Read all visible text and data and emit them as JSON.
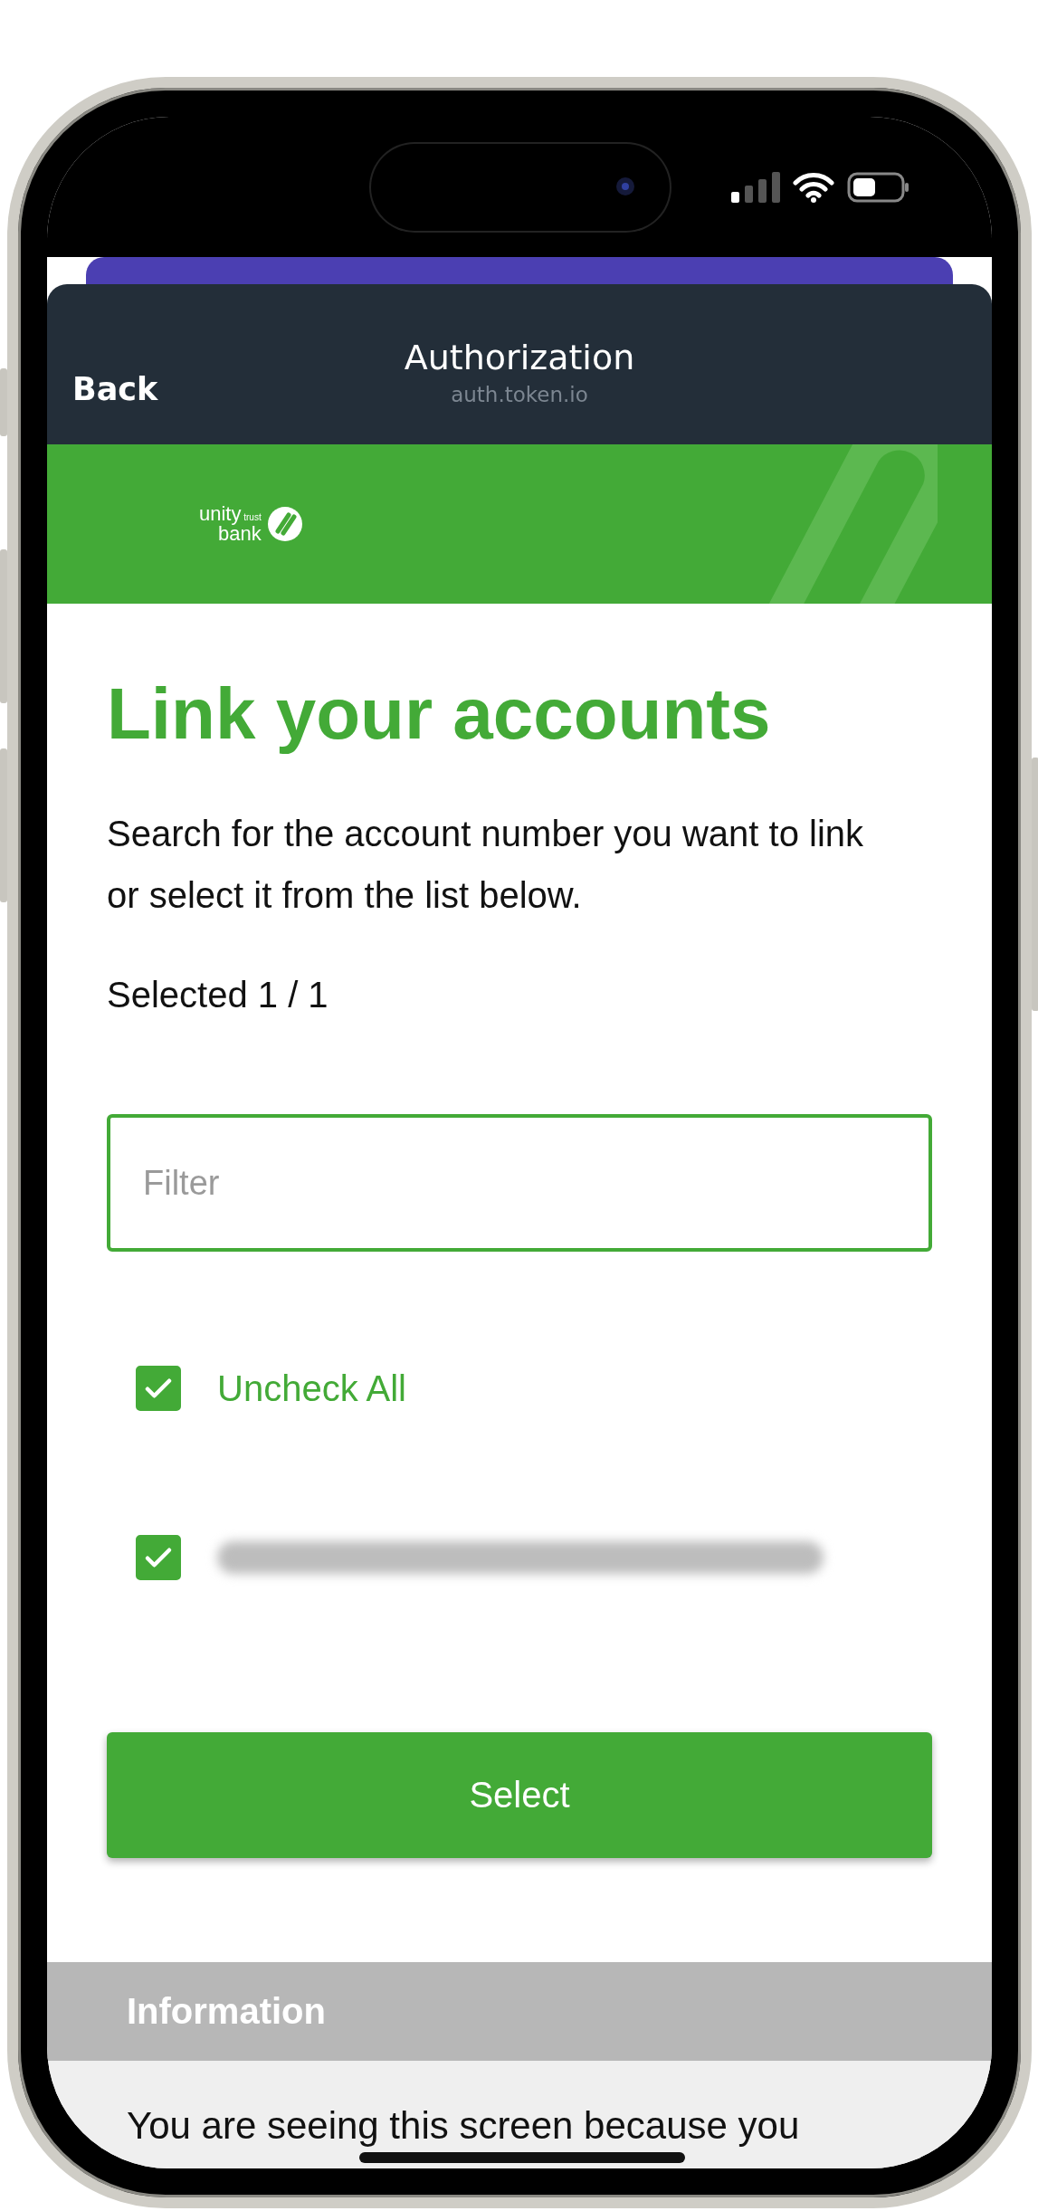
{
  "header": {
    "back": "Back",
    "title": "Authorization",
    "subtitle": "auth.token.io"
  },
  "brand": {
    "logo_line_1": "unity",
    "logo_small": "trust",
    "logo_line_2": "bank"
  },
  "heading": "Link your accounts",
  "instructions": "Search for the account number you want to link or select it from the list below.",
  "selected_count": "Selected 1 / 1",
  "filter": {
    "placeholder": "Filter"
  },
  "select_all": {
    "label": "Uncheck All",
    "checked": true
  },
  "accounts": [
    {
      "checked": true,
      "redacted": true
    }
  ],
  "select_button": "Select",
  "information": {
    "title": "Information",
    "text": "You are seeing this screen because you"
  }
}
